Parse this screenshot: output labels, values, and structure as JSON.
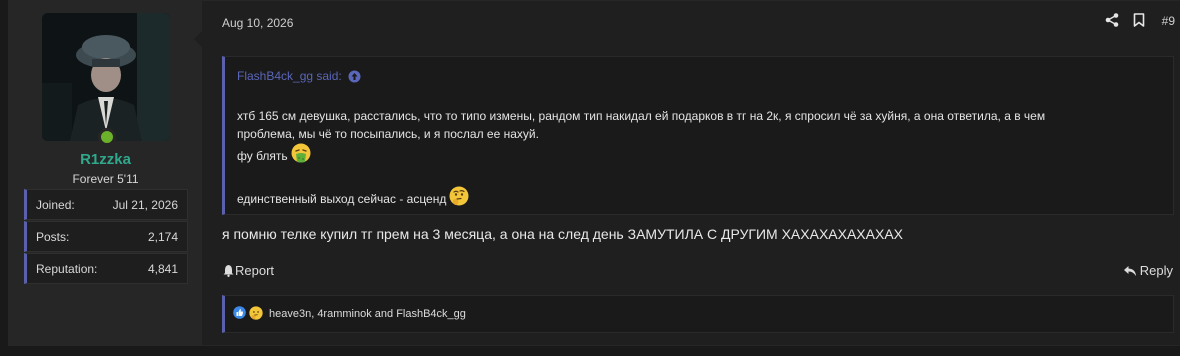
{
  "user": {
    "name": "R1zzka",
    "title": "Forever 5'11",
    "status_color": "#6bb22a",
    "name_color": "#2fa88c",
    "stats": [
      {
        "label": "Joined:",
        "value": "Jul 21, 2026"
      },
      {
        "label": "Posts:",
        "value": "2,174"
      },
      {
        "label": "Reputation:",
        "value": "4,841"
      }
    ]
  },
  "post": {
    "date": "Aug 10, 2026",
    "number": "#9",
    "icons": {
      "share": "share-icon",
      "bookmark": "bookmark-icon"
    }
  },
  "quote": {
    "author": "FlashB4ck_gg said:",
    "line1": "хтб 165 см девушка, расстались, что то типо измены, рандом тип накидал ей подарков в тг на 2к, я спросил чё за хуйня, а она ответила, а в чем",
    "line2": "проблема, мы чё то посыпались, и я послал ее нахуй.",
    "line3": "фу блять",
    "line4": "единственный выход сейчас - асценд",
    "emoji3": "vomiting-face-emoji",
    "emoji4": "thinking-face-emoji"
  },
  "message": "я помню телке купил тг прем на 3 месяца, а она на след день ЗАМУТИЛА С ДРУГИМ ХАХАХАХАХАХАХ",
  "actions": {
    "report": "Report",
    "reply": "Reply"
  },
  "reactions": {
    "text": "heave3n, 4ramminok and FlashB4ck_gg",
    "icons": [
      "like-icon",
      "thinking-face-emoji"
    ]
  },
  "accent": "#5b60ac"
}
